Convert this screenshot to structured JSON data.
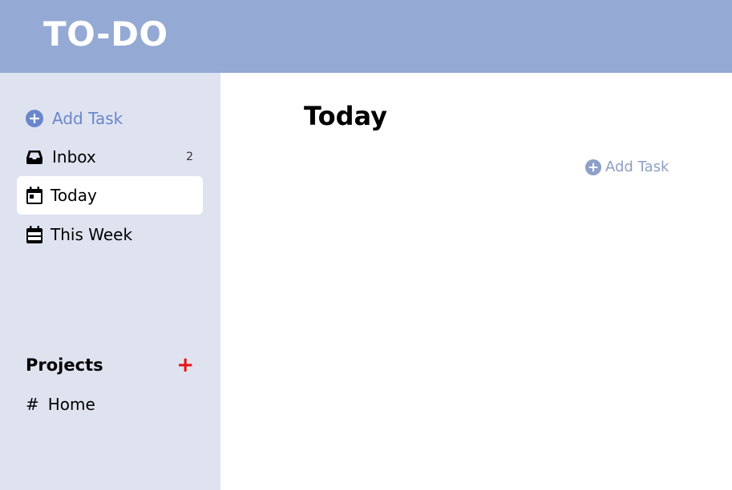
{
  "app": {
    "title": "TO-DO"
  },
  "colors": {
    "header": "#94a9d4",
    "sidebar": "#dfe3f0",
    "accent": "#6b86cc",
    "project_add": "#ee1111"
  },
  "sidebar": {
    "add_task": {
      "label": "Add Task",
      "icon": "plus-circle-icon"
    },
    "items": [
      {
        "label": "Inbox",
        "icon": "inbox-icon",
        "count": "2"
      },
      {
        "label": "Today",
        "icon": "calendar-today-icon",
        "active": true
      },
      {
        "label": "This Week",
        "icon": "calendar-week-icon"
      }
    ],
    "projects": {
      "title": "Projects",
      "add_symbol": "+",
      "items": [
        {
          "label": "Home",
          "icon": "#"
        }
      ]
    }
  },
  "main": {
    "title": "Today",
    "add_task": {
      "label": "Add Task",
      "icon": "plus-circle-icon"
    }
  }
}
